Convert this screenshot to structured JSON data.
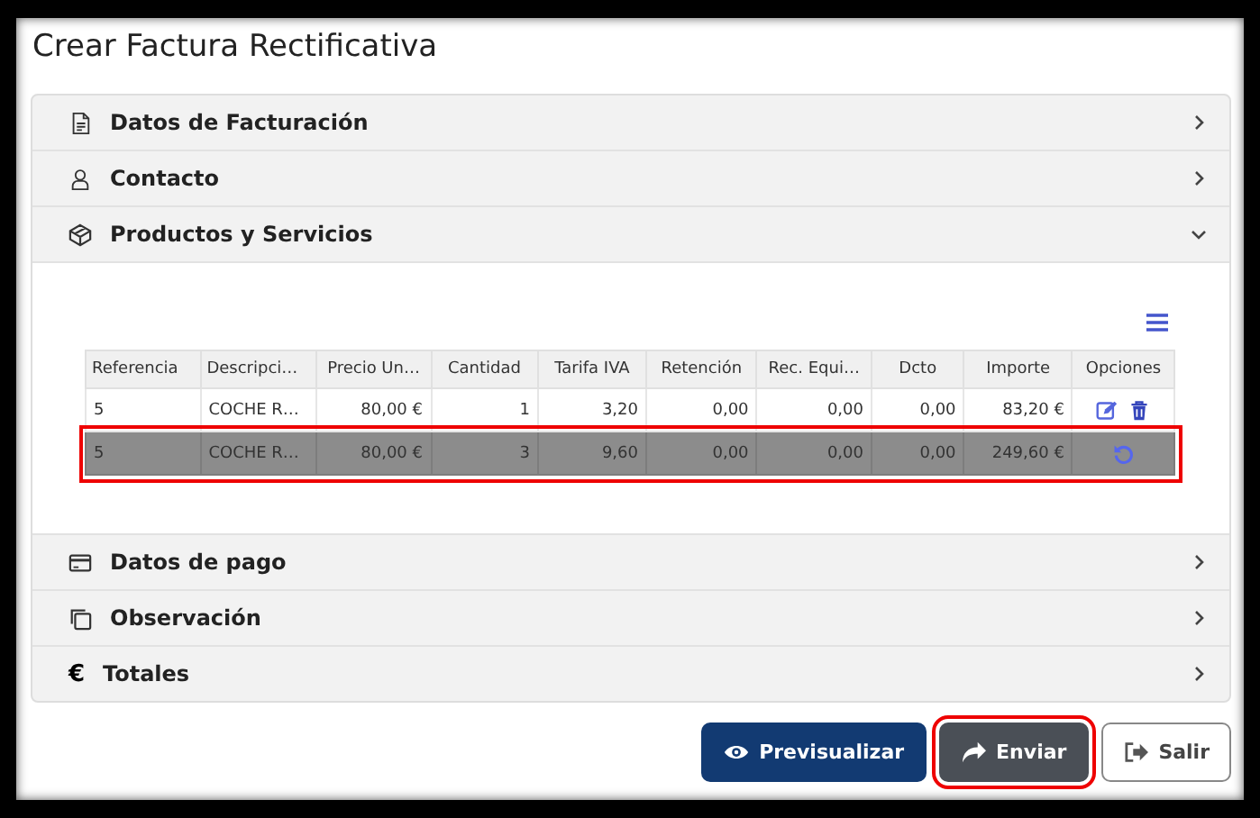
{
  "title": "Crear Factura Rectificativa",
  "sections": [
    {
      "kind": "document",
      "label": "Datos de Facturación",
      "expanded": false
    },
    {
      "kind": "person",
      "label": "Contacto",
      "expanded": false
    },
    {
      "kind": "box",
      "label": "Productos y Servicios",
      "expanded": true
    },
    {
      "kind": "card",
      "label": "Datos de pago",
      "expanded": false
    },
    {
      "kind": "copy",
      "label": "Observación",
      "expanded": false
    },
    {
      "kind": "currency",
      "symbol": "€",
      "label": "Totales",
      "expanded": false
    }
  ],
  "table": {
    "columns": [
      "Referencia",
      "Descripci…",
      "Precio Un…",
      "Cantidad",
      "Tarifa IVA",
      "Retención",
      "Rec. Equi…",
      "Dcto",
      "Importe",
      "Opciones"
    ],
    "rows": [
      {
        "cells": [
          "5",
          "COCHE R…",
          "80,00 €",
          "1",
          "3,20",
          "0,00",
          "0,00",
          "0,00",
          "83,20 €"
        ],
        "removed": false,
        "highlighted": false
      },
      {
        "cells": [
          "5",
          "COCHE R…",
          "80,00 €",
          "3",
          "9,60",
          "0,00",
          "0,00",
          "0,00",
          "249,60 €"
        ],
        "removed": true,
        "highlighted": true
      }
    ]
  },
  "buttons": [
    {
      "kind": "preview",
      "label": "Previsualizar",
      "highlighted": false
    },
    {
      "kind": "send",
      "label": "Enviar",
      "highlighted": true
    },
    {
      "kind": "exit",
      "label": "Salir",
      "highlighted": false
    }
  ]
}
